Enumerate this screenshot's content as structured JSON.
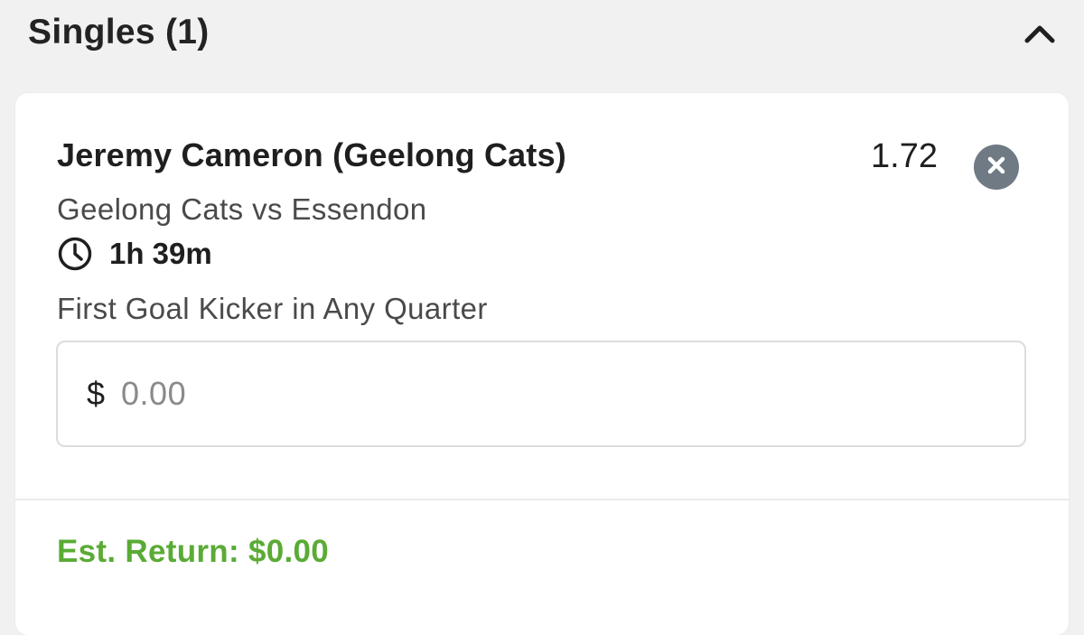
{
  "header": {
    "title": "Singles (1)",
    "collapse_icon": "chevron-up-icon"
  },
  "bet": {
    "selection": "Jeremy Cameron (Geelong Cats)",
    "odds": "1.72",
    "remove_icon": "close-circle-icon",
    "event": "Geelong Cats vs Essendon",
    "time_icon": "clock-icon",
    "time_to_start": "1h 39m",
    "market": "First Goal Kicker in Any Quarter",
    "stake": {
      "currency": "$",
      "placeholder": "0.00",
      "value": ""
    },
    "est_return": "Est. Return: $0.00"
  },
  "colors": {
    "accent_green": "#5aab35",
    "remove_button": "#6f7a84",
    "background": "#f1f1f1"
  }
}
